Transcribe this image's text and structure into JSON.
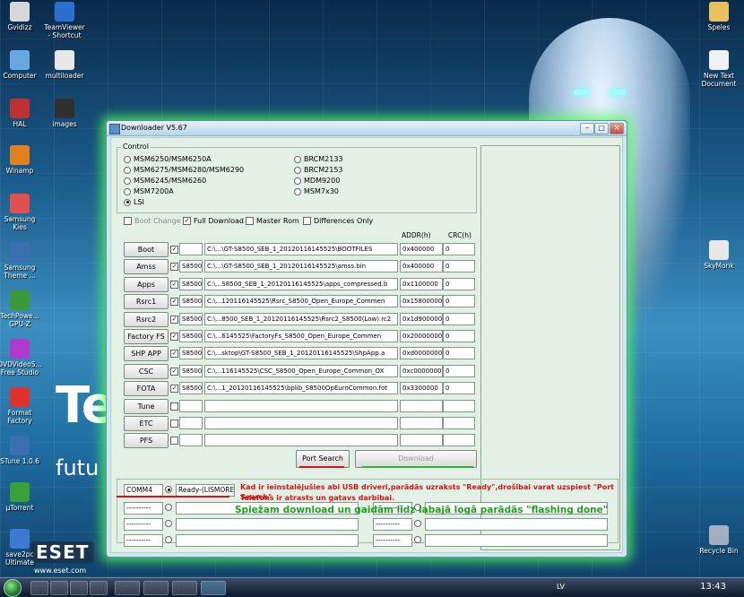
{
  "desktop": {
    "icons_left": [
      {
        "label": "Gvidizz",
        "color": "#d8d8d8"
      },
      {
        "label": "TeamViewer\n- Shortcut",
        "color": "#2a6fd0"
      },
      {
        "label": "Computer",
        "color": "#6aa6e0"
      },
      {
        "label": "multiloader",
        "color": "#e8e8e8"
      },
      {
        "label": "HAL",
        "color": "#c03030"
      },
      {
        "label": "images",
        "color": "#303030"
      },
      {
        "label": "Winamp",
        "color": "#e08020"
      },
      {
        "label": "Samsung\nKies",
        "color": "#e05050"
      },
      {
        "label": "Samsung\nTheme ...",
        "color": "#3a6fb0"
      },
      {
        "label": "TechPowe...\nGPU-Z",
        "color": "#3a9a3a"
      },
      {
        "label": "DVDVideoS...\nFree Studio",
        "color": "#b03ad0"
      },
      {
        "label": "Format\nFactory",
        "color": "#e03030"
      },
      {
        "label": "STune 1.0.6",
        "color": "#3a6fb0"
      },
      {
        "label": "µTorrent",
        "color": "#3aa03a"
      },
      {
        "label": "save2pc\nUltimate",
        "color": "#3a7ad0"
      }
    ],
    "icons_right": [
      {
        "label": "Speles",
        "color": "#e8c060"
      },
      {
        "label": "New Text\nDocument",
        "color": "#f0f0f0"
      },
      {
        "label": "SkyMonk",
        "color": "#e8e8e8"
      },
      {
        "label": "Recycle Bin",
        "color": "#a0b0c0"
      }
    ],
    "wallpaper_big_text": "Te",
    "wallpaper_sub_text": "futu",
    "eset_logo": "ESET",
    "eset_url": "www.eset.com"
  },
  "taskbar": {
    "language": "LV",
    "clock": "13:43"
  },
  "window": {
    "title": "Downloader V5.67",
    "minimize": "–",
    "maximize": "□",
    "close": "✕",
    "control_label": "Control",
    "chips_left": [
      {
        "label": "MSM6250/MSM6250A",
        "selected": false
      },
      {
        "label": "MSM6275/MSM6280/MSM6290",
        "selected": false
      },
      {
        "label": "MSM6245/MSM6260",
        "selected": false
      },
      {
        "label": "MSM7200A",
        "selected": false
      },
      {
        "label": "LSI",
        "selected": true
      }
    ],
    "chips_right": [
      {
        "label": "BRCM2133",
        "selected": false
      },
      {
        "label": "BRCM2153",
        "selected": false
      },
      {
        "label": "MDM9200",
        "selected": false
      },
      {
        "label": "MSM7x30",
        "selected": false
      }
    ],
    "options": [
      {
        "label": "Boot Change",
        "checked": false,
        "enabled": false
      },
      {
        "label": "Full Download",
        "checked": true,
        "enabled": true
      },
      {
        "label": "Master Rom",
        "checked": false,
        "enabled": true
      },
      {
        "label": "Differences Only",
        "checked": false,
        "enabled": true
      }
    ],
    "col_addr": "ADDR(h)",
    "col_crc": "CRC(h)",
    "rows": [
      {
        "label": "Boot",
        "checked": true,
        "model": "",
        "path": "C:\\...\\GT-S8500_SEB_1_20120116145525\\BOOTFILES",
        "addr": "0x400000",
        "crc": "0"
      },
      {
        "label": "Amss",
        "checked": true,
        "model": "S8500",
        "path": "C:\\...\\GT-S8500_SEB_1_20120116145525\\amss.bin",
        "addr": "0x400000",
        "crc": "0"
      },
      {
        "label": "Apps",
        "checked": true,
        "model": "S8500",
        "path": "C:\\...S8500_SEB_1_20120116145525\\apps_compressed.b",
        "addr": "0x1100000",
        "crc": "0"
      },
      {
        "label": "Rsrc1",
        "checked": true,
        "model": "S8500",
        "path": "C:\\...120116145525\\Rsrc_S8500_Open_Europe_Commen",
        "addr": "0x15800000",
        "crc": "0"
      },
      {
        "label": "Rsrc2",
        "checked": true,
        "model": "S8500",
        "path": "C:\\...8500_SEB_1_20120116145525\\Rsrc2_S8500(Low).rc2",
        "addr": "0x1d900000",
        "crc": "0"
      },
      {
        "label": "Factory FS",
        "checked": true,
        "model": "S8500",
        "path": "C:\\...6145525\\FactoryFs_S8500_Open_Europe_Commen",
        "addr": "0x20000000",
        "crc": "0"
      },
      {
        "label": "SHP APP",
        "checked": true,
        "model": "S8500",
        "path": "C:\\...sktop\\GT-S8500_SEB_1_20120116145525\\ShpApp.a",
        "addr": "0xd0000000",
        "crc": "0"
      },
      {
        "label": "CSC",
        "checked": true,
        "model": "S8500",
        "path": "C:\\...116145525\\CSC_S8500_Open_Europe_Common_OX",
        "addr": "0xc0000000",
        "crc": "0"
      },
      {
        "label": "FOTA",
        "checked": true,
        "model": "S8500",
        "path": "C:\\...1_20120116145525\\bplib_S8500OpEuroCommon.fot",
        "addr": "0x3300000",
        "crc": "0"
      },
      {
        "label": "Tune",
        "checked": false,
        "model": "",
        "path": "",
        "addr": "",
        "crc": ""
      },
      {
        "label": "ETC",
        "checked": false,
        "model": "",
        "path": "",
        "addr": "",
        "crc": ""
      },
      {
        "label": "PFS",
        "checked": false,
        "model": "",
        "path": "",
        "addr": "",
        "crc": ""
      }
    ],
    "port_search": "Port Search",
    "download": "Download",
    "ports": [
      {
        "port": "COMM4",
        "status": "Ready-(LISMORE)",
        "selected": true
      },
      {
        "port": "----------",
        "status": "",
        "selected": false
      },
      {
        "port": "----------",
        "status": "",
        "selected": false
      },
      {
        "port": "----------",
        "status": "",
        "selected": false
      },
      {
        "port": "----------",
        "status": "",
        "selected": false
      },
      {
        "port": "----------",
        "status": "",
        "selected": false
      },
      {
        "port": "----------",
        "status": "",
        "selected": false
      }
    ]
  },
  "annotations": {
    "red_line1": "Kad ir ieinstalējušies abi USB driveri,parādās uzraksts \"Ready\",drošībai varat uzspiest \"Port Search\"",
    "red_line2": "Telefons ir atrasts un gatavs darbībai.",
    "green": "Spiežam download un gaidām līdz labajā logā parādās \"flashing done\"",
    "colors": {
      "red": "#d01818",
      "green": "#20a020",
      "glow": "#50ff50"
    }
  }
}
